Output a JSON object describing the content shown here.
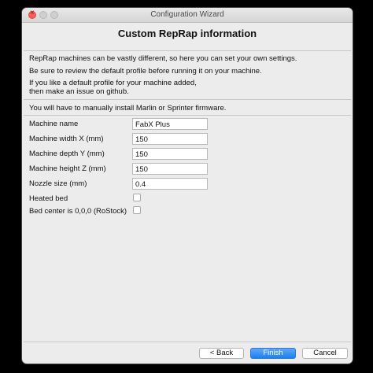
{
  "window": {
    "title": "Configuration Wizard"
  },
  "page": {
    "heading": "Custom RepRap information",
    "intro_lines": [
      "RepRap machines can be vastly different, so here you can set your own settings.",
      "Be sure to review the default profile before running it on your machine.",
      "If you like a default profile for your machine added,",
      "then make an issue on github."
    ],
    "firmware_note": "You will have to manually install Marlin or Sprinter firmware."
  },
  "form": {
    "machine_name": {
      "label": "Machine name",
      "value": "FabX Plus"
    },
    "machine_width": {
      "label": "Machine width X (mm)",
      "value": "150"
    },
    "machine_depth": {
      "label": "Machine depth Y (mm)",
      "value": "150"
    },
    "machine_height": {
      "label": "Machine height Z (mm)",
      "value": "150"
    },
    "nozzle_size": {
      "label": "Nozzle size (mm)",
      "value": "0.4"
    },
    "heated_bed": {
      "label": "Heated bed",
      "checked": false
    },
    "bed_center": {
      "label": "Bed center is 0,0,0 (RoStock)",
      "checked": false
    }
  },
  "buttons": {
    "back": "< Back",
    "finish": "Finish",
    "cancel": "Cancel"
  },
  "colors": {
    "accent": "#1c7ff0",
    "close_button": "#fc5f57",
    "window_bg": "#ececec"
  }
}
